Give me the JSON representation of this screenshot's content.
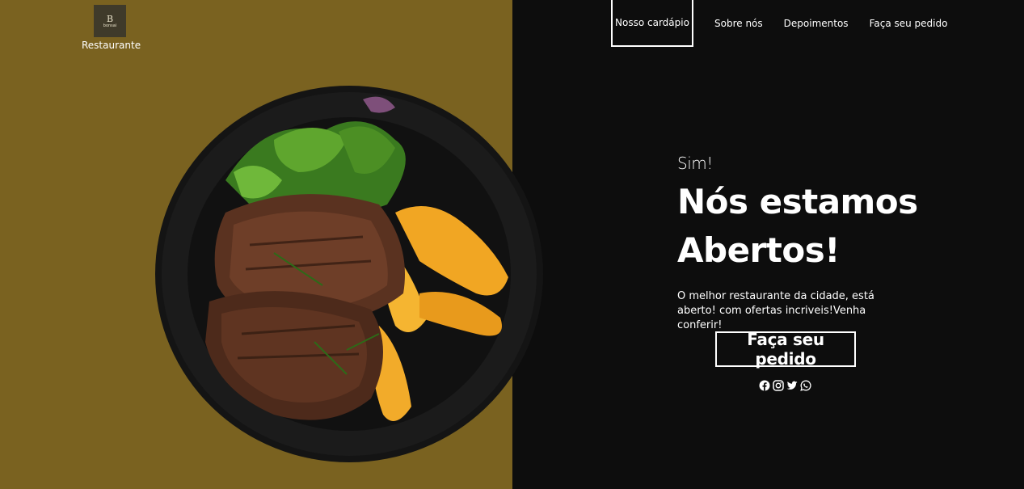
{
  "brand": {
    "logo_letter": "B",
    "logo_sub": "bonsai",
    "name": "Restaurante"
  },
  "nav": {
    "items": [
      {
        "label": "Nosso cardápio",
        "active": true
      },
      {
        "label": "Sobre nós",
        "active": false
      },
      {
        "label": "Depoimentos",
        "active": false
      },
      {
        "label": "Faça seu pedido",
        "active": false
      }
    ]
  },
  "hero": {
    "kicker": "Sim!",
    "title_line1": "Nós estamos",
    "title_line2": "Abertos!",
    "description": "O melhor restaurante da cidade, está aberto! com ofertas incriveis!Venha conferir!",
    "cta_label": "Faça seu pedido"
  },
  "social": {
    "icons": [
      "facebook-icon",
      "instagram-icon",
      "twitter-icon",
      "whatsapp-icon"
    ]
  },
  "colors": {
    "left_panel": "#7a6220",
    "right_panel": "#0d0d0d",
    "text": "#ffffff"
  }
}
